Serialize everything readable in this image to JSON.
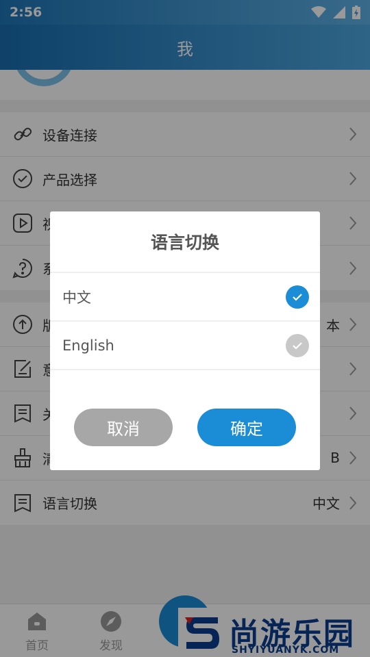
{
  "status": {
    "time": "2:56"
  },
  "header": {
    "title": "我"
  },
  "menu_group_1": [
    {
      "label": "设备连接",
      "icon": "link-icon"
    },
    {
      "label": "产品选择",
      "icon": "check-circle-icon"
    },
    {
      "label": "视",
      "icon": "play-icon"
    },
    {
      "label": "系",
      "icon": "question-icon"
    }
  ],
  "menu_group_2": [
    {
      "label": "版",
      "icon": "upload-icon",
      "value": "本"
    },
    {
      "label": "意",
      "icon": "edit-icon"
    },
    {
      "label": "关",
      "icon": "bookmark-icon"
    },
    {
      "label": "清",
      "icon": "broom-icon",
      "value": "B"
    },
    {
      "label": "语言切换",
      "icon": "bookmark-icon",
      "value": "中文"
    }
  ],
  "tabs": {
    "home": "首页",
    "discover": "发现"
  },
  "watermark": {
    "cn": "尚游乐园",
    "en": "SHYIYUANYK.COM"
  },
  "dialog": {
    "title": "语言切换",
    "options": [
      {
        "label": "中文",
        "selected": true
      },
      {
        "label": "English",
        "selected": false
      }
    ],
    "cancel": "取消",
    "confirm": "确定"
  },
  "colors": {
    "accent": "#1a8dd6",
    "header": "#1a6eaf",
    "disabled": "#a7a7a7"
  }
}
